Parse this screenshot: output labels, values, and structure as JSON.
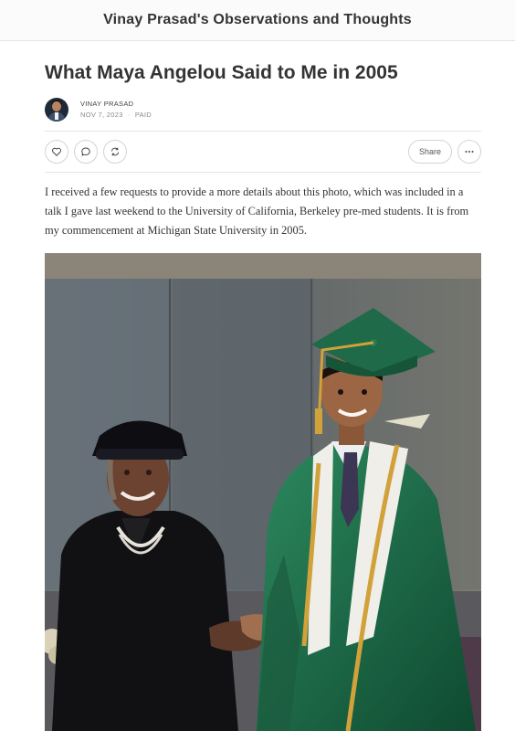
{
  "header": {
    "publication_title": "Vinay Prasad's Observations and Thoughts"
  },
  "post": {
    "title": "What Maya Angelou Said to Me in 2005",
    "author": "VINAY PRASAD",
    "date": "NOV 7, 2023",
    "access": "PAID",
    "separator": "∙",
    "body_paragraph": "I received a few requests to provide a more details about this photo, which was included in a talk I gave last weekend to the University of California, Berkeley pre-med students. It is from my commencement at Michigan State University in 2005."
  },
  "actions": {
    "like_icon": "heart-icon",
    "comment_icon": "comment-icon",
    "restack_icon": "restack-icon",
    "share_label": "Share",
    "more_icon": "ellipsis-icon"
  },
  "colors": {
    "text": "#333333",
    "muted": "#8a8a8a",
    "border": "#e4e4e4",
    "gown_green": "#1f6a48",
    "stole_gold": "#c9962f"
  }
}
